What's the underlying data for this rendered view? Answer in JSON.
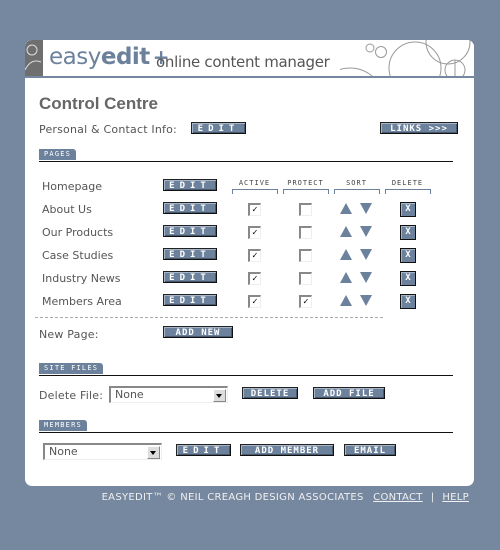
{
  "header": {
    "logo_light": "easy",
    "logo_bold": "edit",
    "logo_plus": "+",
    "tagline": "online content manager"
  },
  "title": "Control Centre",
  "personal": {
    "label": "Personal & Contact Info:",
    "edit_label": "EDIT",
    "links_label": "LINKS >>>"
  },
  "pages": {
    "section_label": "PAGES",
    "columns": [
      "ACTIVE",
      "PROTECT",
      "SORT",
      "DELETE"
    ],
    "homepage": {
      "name": "Homepage",
      "edit_label": "EDIT"
    },
    "rows": [
      {
        "name": "About Us",
        "edit_label": "EDIT",
        "active": true,
        "protect": false,
        "delete_label": "X"
      },
      {
        "name": "Our Products",
        "edit_label": "EDIT",
        "active": true,
        "protect": false,
        "delete_label": "X"
      },
      {
        "name": "Case Studies",
        "edit_label": "EDIT",
        "active": true,
        "protect": false,
        "delete_label": "X"
      },
      {
        "name": "Industry News",
        "edit_label": "EDIT",
        "active": true,
        "protect": false,
        "delete_label": "X"
      },
      {
        "name": "Members Area",
        "edit_label": "EDIT",
        "active": true,
        "protect": true,
        "delete_label": "X"
      }
    ],
    "new_page_label": "New Page:",
    "add_new_label": "ADD NEW"
  },
  "site_files": {
    "section_label": "SITE FILES",
    "delete_file_label": "Delete File:",
    "selected": "None",
    "delete_label": "DELETE",
    "add_file_label": "ADD FILE"
  },
  "members": {
    "section_label": "MEMBERS",
    "selected": "None",
    "edit_label": "EDIT",
    "add_member_label": "ADD MEMBER",
    "email_label": "EMAIL"
  },
  "footer": {
    "copyright": "EASYEDIT™ © NEIL CREAGH DESIGN ASSOCIATES",
    "contact_label": "CONTACT",
    "separator": "|",
    "help_label": "HELP"
  },
  "colors": {
    "background": "#76889f",
    "accent": "#6c819b"
  }
}
